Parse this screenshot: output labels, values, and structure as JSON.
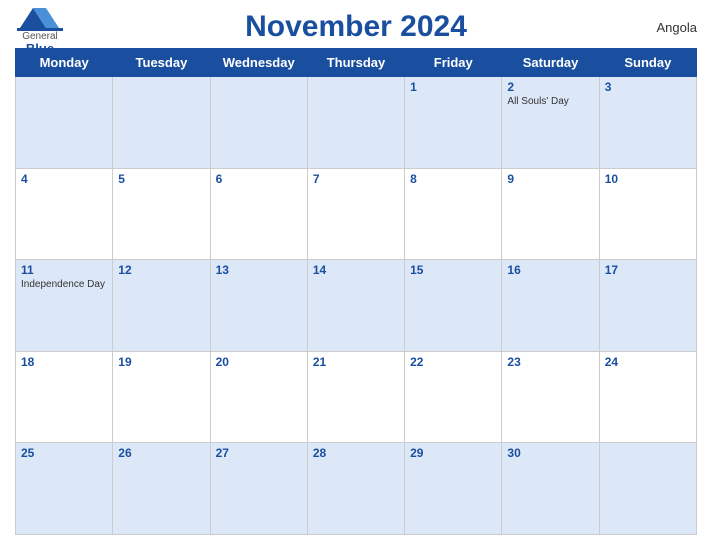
{
  "header": {
    "logo_general": "General",
    "logo_blue": "Blue",
    "title": "November 2024",
    "country": "Angola"
  },
  "calendar": {
    "days_of_week": [
      "Monday",
      "Tuesday",
      "Wednesday",
      "Thursday",
      "Friday",
      "Saturday",
      "Sunday"
    ],
    "weeks": [
      [
        {
          "day": "",
          "holiday": ""
        },
        {
          "day": "",
          "holiday": ""
        },
        {
          "day": "",
          "holiday": ""
        },
        {
          "day": "",
          "holiday": ""
        },
        {
          "day": "1",
          "holiday": ""
        },
        {
          "day": "2",
          "holiday": "All Souls' Day"
        },
        {
          "day": "3",
          "holiday": ""
        }
      ],
      [
        {
          "day": "4",
          "holiday": ""
        },
        {
          "day": "5",
          "holiday": ""
        },
        {
          "day": "6",
          "holiday": ""
        },
        {
          "day": "7",
          "holiday": ""
        },
        {
          "day": "8",
          "holiday": ""
        },
        {
          "day": "9",
          "holiday": ""
        },
        {
          "day": "10",
          "holiday": ""
        }
      ],
      [
        {
          "day": "11",
          "holiday": "Independence Day"
        },
        {
          "day": "12",
          "holiday": ""
        },
        {
          "day": "13",
          "holiday": ""
        },
        {
          "day": "14",
          "holiday": ""
        },
        {
          "day": "15",
          "holiday": ""
        },
        {
          "day": "16",
          "holiday": ""
        },
        {
          "day": "17",
          "holiday": ""
        }
      ],
      [
        {
          "day": "18",
          "holiday": ""
        },
        {
          "day": "19",
          "holiday": ""
        },
        {
          "day": "20",
          "holiday": ""
        },
        {
          "day": "21",
          "holiday": ""
        },
        {
          "day": "22",
          "holiday": ""
        },
        {
          "day": "23",
          "holiday": ""
        },
        {
          "day": "24",
          "holiday": ""
        }
      ],
      [
        {
          "day": "25",
          "holiday": ""
        },
        {
          "day": "26",
          "holiday": ""
        },
        {
          "day": "27",
          "holiday": ""
        },
        {
          "day": "28",
          "holiday": ""
        },
        {
          "day": "29",
          "holiday": ""
        },
        {
          "day": "30",
          "holiday": ""
        },
        {
          "day": "",
          "holiday": ""
        }
      ]
    ]
  }
}
